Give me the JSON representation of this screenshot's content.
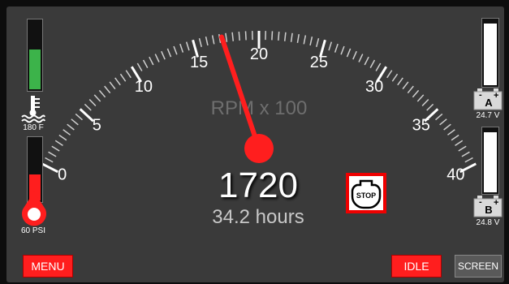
{
  "gauge": {
    "unit_label": "RPM x 100",
    "tick_labels": [
      "0",
      "5",
      "10",
      "15",
      "20",
      "25",
      "30",
      "35",
      "40"
    ],
    "min": 0,
    "max": 40,
    "needle_value": 17.2
  },
  "readout": {
    "rpm": "1720",
    "hours": "34.2 hours"
  },
  "coolant": {
    "label": "180 F",
    "level": 0.6,
    "color": "#3cb34a"
  },
  "oil": {
    "label": "60 PSI",
    "level": 0.45,
    "color": "#ff1e1e"
  },
  "battery_a": {
    "letter": "A",
    "label": "24.7 V",
    "level": 0.95
  },
  "battery_b": {
    "letter": "B",
    "label": "24.8 V",
    "level": 0.95
  },
  "stop": {
    "label": "STOP"
  },
  "buttons": {
    "menu": "MENU",
    "idle": "IDLE",
    "screen": "SCREEN"
  },
  "colors": {
    "needle": "#ff1e1e",
    "background": "#3a3a3a"
  }
}
